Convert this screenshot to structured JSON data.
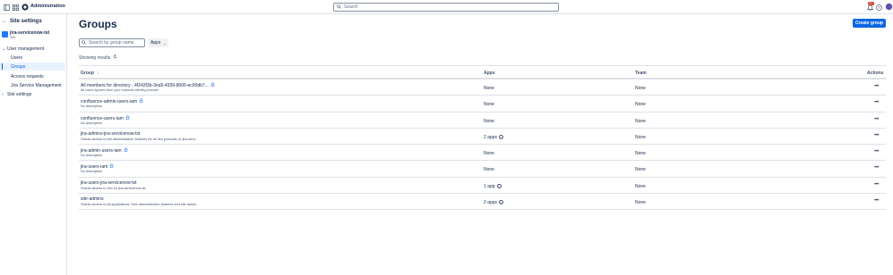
{
  "topbar": {
    "title": "Administration",
    "search_placeholder": "Search",
    "notification_count": "9+"
  },
  "sidebar": {
    "back_title": "Site settings",
    "site_name": "jira-servicenow-tst",
    "site_sub": "Site",
    "items": [
      {
        "label": "User management"
      },
      {
        "label": "Users"
      },
      {
        "label": "Groups"
      },
      {
        "label": "Access requests"
      },
      {
        "label": "Jira Service Management"
      },
      {
        "label": "Site settings"
      }
    ]
  },
  "main": {
    "title": "Groups",
    "create_button": "Create group",
    "search_placeholder": "Search by group name",
    "apps_filter": "Apps",
    "showing_results": "Showing results"
  },
  "table": {
    "headers": {
      "group": "Group",
      "apps": "Apps",
      "team": "Team",
      "actions": "Actions"
    },
    "rows": [
      {
        "name": "All members for directory - 4f242f3b-3ea5-4939-8006-ec90db7...",
        "desc": "All users synced from your external identity provider",
        "apps": "None",
        "team": "None",
        "lock": true,
        "info": false
      },
      {
        "name": "confluence-admin-users-iam",
        "desc": "No description",
        "apps": "None",
        "team": "None",
        "lock": true,
        "info": false
      },
      {
        "name": "confluence-users-iam",
        "desc": "No description",
        "apps": "None",
        "team": "None",
        "lock": true,
        "info": false
      },
      {
        "name": "jira-admins-jira-servicenow-tst",
        "desc": "Grants access to the administration features for all Jira products on jira-servi...",
        "apps": "2 apps",
        "team": "None",
        "lock": false,
        "info": true
      },
      {
        "name": "jira-admin-users-iam",
        "desc": "No description",
        "apps": "None",
        "team": "None",
        "lock": true,
        "info": false
      },
      {
        "name": "jira-users-iam",
        "desc": "No description",
        "apps": "None",
        "team": "None",
        "lock": true,
        "info": false
      },
      {
        "name": "jira-users-jira-servicenow-tst",
        "desc": "Grants access to Jira on jira-servicenow-tst",
        "apps": "1 app",
        "team": "None",
        "lock": false,
        "info": true
      },
      {
        "name": "site-admins",
        "desc": "Grants access to all applications, their administration features and site admin...",
        "apps": "2 apps",
        "team": "None",
        "lock": false,
        "info": true
      }
    ]
  },
  "colors": {
    "accent": "#0c66e4",
    "badge": "#c9372c"
  }
}
